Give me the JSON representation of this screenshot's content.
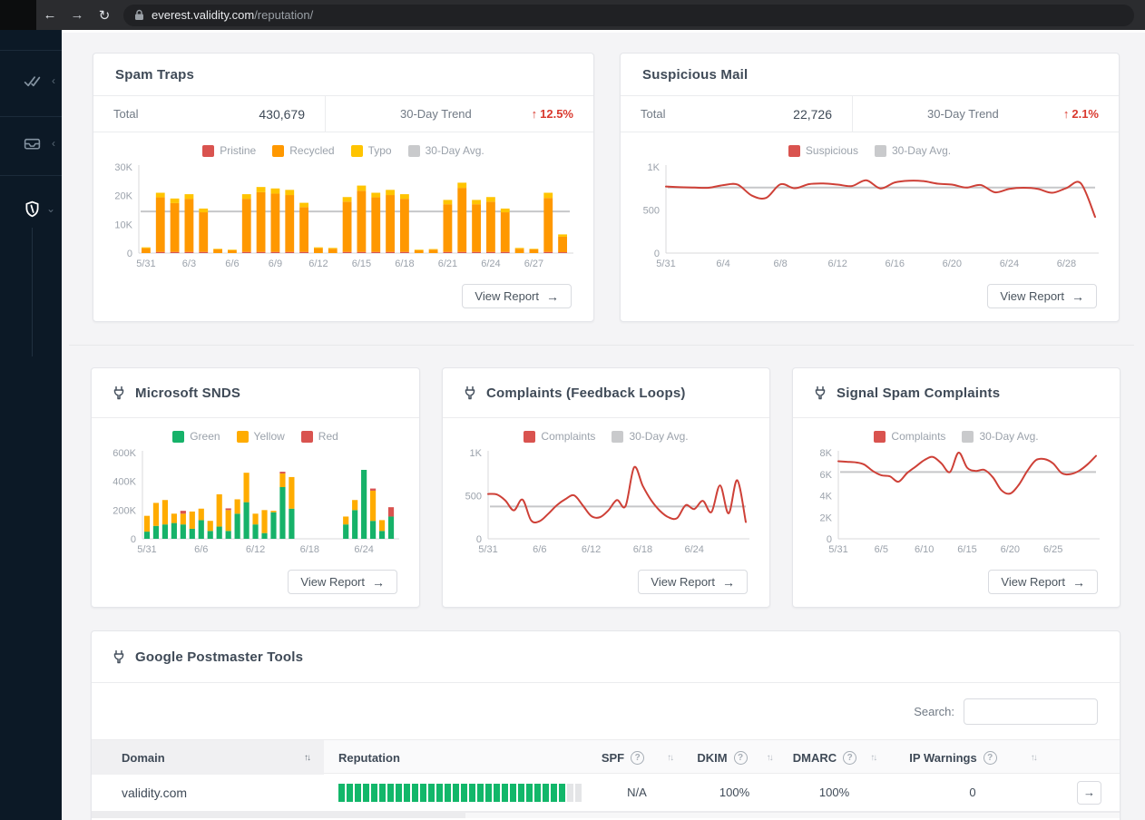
{
  "browser": {
    "url_host": "everest.validity.com",
    "url_path": "/reputation/"
  },
  "sidebar": {
    "items": [
      {
        "name": "approvals"
      },
      {
        "name": "inbox"
      },
      {
        "name": "reputation",
        "active": true
      }
    ]
  },
  "cards": {
    "spam_traps": {
      "title": "Spam Traps",
      "total_label": "Total",
      "total_value": "430,679",
      "trend_label": "30-Day Trend",
      "trend_value": "12.5%",
      "view_report": "View Report"
    },
    "suspicious_mail": {
      "title": "Suspicious Mail",
      "total_label": "Total",
      "total_value": "22,726",
      "trend_label": "30-Day Trend",
      "trend_value": "2.1%",
      "view_report": "View Report"
    },
    "microsoft_snds": {
      "title": "Microsoft SNDS",
      "view_report": "View Report"
    },
    "complaints_fbl": {
      "title": "Complaints (Feedback Loops)",
      "view_report": "View Report"
    },
    "signal_spam": {
      "title": "Signal Spam Complaints",
      "view_report": "View Report"
    },
    "google_postmaster": {
      "title": "Google Postmaster Tools",
      "search_label": "Search:",
      "search_value": "",
      "table": {
        "columns": [
          {
            "label": "Domain",
            "sortable": true
          },
          {
            "label": "Reputation"
          },
          {
            "label": "SPF",
            "help": true,
            "sortable": true
          },
          {
            "label": "DKIM",
            "help": true,
            "sortable": true
          },
          {
            "label": "DMARC",
            "help": true,
            "sortable": true
          },
          {
            "label": "IP Warnings",
            "help": true,
            "sortable": true
          }
        ],
        "rows": [
          {
            "domain": "validity.com",
            "reputation_segments_total": 30,
            "reputation_segments_filled": 28,
            "spf": "N/A",
            "dkim": "100%",
            "dmarc": "100%",
            "ip_warnings": "0"
          }
        ]
      }
    }
  },
  "chart_data": [
    {
      "id": "spam_traps",
      "type": "bar",
      "stacked": true,
      "categories": [
        "5/31",
        "6/1",
        "6/2",
        "6/3",
        "6/4",
        "6/5",
        "6/6",
        "6/7",
        "6/8",
        "6/9",
        "6/10",
        "6/11",
        "6/12",
        "6/13",
        "6/14",
        "6/15",
        "6/16",
        "6/17",
        "6/18",
        "6/19",
        "6/20",
        "6/21",
        "6/22",
        "6/23",
        "6/24",
        "6/25",
        "6/26",
        "6/27",
        "6/28",
        "6/29"
      ],
      "series": [
        {
          "name": "Pristine",
          "color": "#d9534f",
          "values": [
            0,
            0.4,
            0.4,
            0.4,
            0.4,
            0,
            0,
            0.4,
            0.4,
            0.4,
            0.4,
            0.4,
            0,
            0,
            0.4,
            0.4,
            0.4,
            0.4,
            0.4,
            0,
            0,
            0.4,
            0.4,
            0.4,
            0.4,
            0.4,
            0,
            0,
            0.4,
            0.3
          ]
        },
        {
          "name": "Recycled",
          "color": "#ff9800",
          "values": [
            1.7,
            19,
            17,
            18.5,
            13.8,
            1.3,
            1,
            18.5,
            20.8,
            20.3,
            19.8,
            15.6,
            1.7,
            1.5,
            17.5,
            21.3,
            19,
            19.8,
            18.5,
            1,
            1.2,
            16.6,
            22.3,
            16.6,
            17.5,
            13.8,
            1.5,
            1.3,
            18.8,
            5.4
          ]
        },
        {
          "name": "Typo",
          "color": "#ffc400",
          "values": [
            0.3,
            1.6,
            1.6,
            1.6,
            1.3,
            0.2,
            0.2,
            1.6,
            1.8,
            1.8,
            1.8,
            1.5,
            0.3,
            0.3,
            1.6,
            1.8,
            1.6,
            1.8,
            1.6,
            0.2,
            0.2,
            1.5,
            1.8,
            1.5,
            1.6,
            1.3,
            0.3,
            0.2,
            1.8,
            0.8
          ]
        }
      ],
      "legend": [
        {
          "label": "Pristine",
          "color": "#d9534f"
        },
        {
          "label": "Recycled",
          "color": "#ff9800"
        },
        {
          "label": "Typo",
          "color": "#ffc400"
        },
        {
          "label": "30-Day Avg.",
          "color": "#c9cacc"
        }
      ],
      "avg_line": 14.5,
      "ylim": [
        0,
        30
      ],
      "yticks": [
        {
          "v": 0,
          "label": "0"
        },
        {
          "v": 10,
          "label": "10K"
        },
        {
          "v": 20,
          "label": "20K"
        },
        {
          "v": 30,
          "label": "30K"
        }
      ],
      "xticks": [
        "5/31",
        "6/3",
        "6/6",
        "6/9",
        "6/12",
        "6/15",
        "6/18",
        "6/21",
        "6/24",
        "6/27"
      ],
      "unit": "K",
      "padL": 40
    },
    {
      "id": "suspicious_mail",
      "type": "line",
      "categories": [
        "5/31",
        "6/1",
        "6/2",
        "6/3",
        "6/4",
        "6/5",
        "6/6",
        "6/7",
        "6/8",
        "6/9",
        "6/10",
        "6/11",
        "6/12",
        "6/13",
        "6/14",
        "6/15",
        "6/16",
        "6/17",
        "6/18",
        "6/19",
        "6/20",
        "6/21",
        "6/22",
        "6/23",
        "6/24",
        "6/25",
        "6/26",
        "6/27",
        "6/28",
        "6/29",
        "6/30"
      ],
      "series": [
        {
          "name": "Suspicious",
          "color": "#ce4037",
          "values": [
            772,
            765,
            760,
            758,
            788,
            795,
            668,
            640,
            798,
            752,
            800,
            808,
            795,
            778,
            845,
            750,
            820,
            840,
            835,
            805,
            795,
            760,
            790,
            705,
            745,
            758,
            745,
            700,
            755,
            810,
            420
          ]
        }
      ],
      "legend": [
        {
          "label": "Suspicious",
          "color": "#d9534f"
        },
        {
          "label": "30-Day Avg.",
          "color": "#c9cacc"
        }
      ],
      "avg_line": 760,
      "ylim": [
        0,
        1000
      ],
      "yticks": [
        {
          "v": 0,
          "label": "0"
        },
        {
          "v": 500,
          "label": "500"
        },
        {
          "v": 1000,
          "label": "1K"
        }
      ],
      "xticks": [
        "5/31",
        "6/4",
        "6/8",
        "6/12",
        "6/16",
        "6/20",
        "6/24",
        "6/28"
      ],
      "padL": 40
    },
    {
      "id": "microsoft_snds",
      "type": "bar",
      "stacked": true,
      "categories": [
        "5/31",
        "6/1",
        "6/2",
        "6/3",
        "6/4",
        "6/5",
        "6/6",
        "6/7",
        "6/8",
        "6/9",
        "6/10",
        "6/11",
        "6/12",
        "6/13",
        "6/14",
        "6/15",
        "6/16",
        "6/17",
        "6/18",
        "6/19",
        "6/20",
        "6/21",
        "6/22",
        "6/23",
        "6/24",
        "6/25",
        "6/26",
        "6/27"
      ],
      "series": [
        {
          "name": "Green",
          "color": "#16b269",
          "values": [
            50,
            90,
            100,
            110,
            100,
            70,
            130,
            55,
            85,
            55,
            175,
            255,
            100,
            40,
            185,
            360,
            210,
            0,
            0,
            0,
            0,
            0,
            100,
            200,
            480,
            125,
            55,
            155
          ]
        },
        {
          "name": "Yellow",
          "color": "#ffac00",
          "values": [
            110,
            160,
            170,
            65,
            75,
            120,
            80,
            70,
            225,
            145,
            100,
            205,
            75,
            160,
            10,
            95,
            220,
            0,
            0,
            0,
            0,
            0,
            55,
            70,
            0,
            210,
            75,
            0
          ]
        },
        {
          "name": "Red",
          "color": "#d9534f",
          "values": [
            0,
            0,
            0,
            0,
            20,
            0,
            0,
            0,
            0,
            12,
            0,
            0,
            0,
            0,
            0,
            12,
            0,
            0,
            0,
            0,
            0,
            0,
            0,
            0,
            0,
            15,
            0,
            65
          ]
        }
      ],
      "legend": [
        {
          "label": "Green",
          "color": "#16b269"
        },
        {
          "label": "Yellow",
          "color": "#ffac00"
        },
        {
          "label": "Red",
          "color": "#d9534f"
        }
      ],
      "ylim": [
        0,
        600
      ],
      "yticks": [
        {
          "v": 0,
          "label": "0"
        },
        {
          "v": 200,
          "label": "200K"
        },
        {
          "v": 400,
          "label": "400K"
        },
        {
          "v": 600,
          "label": "600K"
        }
      ],
      "xticks": [
        "5/31",
        "6/6",
        "6/12",
        "6/18",
        "6/24"
      ],
      "unit": "K",
      "padL": 46
    },
    {
      "id": "complaints_fbl",
      "type": "line",
      "categories": [
        "5/31",
        "6/1",
        "6/2",
        "6/3",
        "6/4",
        "6/5",
        "6/6",
        "6/7",
        "6/8",
        "6/9",
        "6/10",
        "6/11",
        "6/12",
        "6/13",
        "6/14",
        "6/15",
        "6/16",
        "6/17",
        "6/18",
        "6/19",
        "6/20",
        "6/21",
        "6/22",
        "6/23",
        "6/24",
        "6/25",
        "6/26",
        "6/27",
        "6/28",
        "6/29",
        "6/30"
      ],
      "series": [
        {
          "name": "Complaints",
          "color": "#ce4037",
          "values": [
            520,
            515,
            445,
            330,
            455,
            215,
            205,
            290,
            390,
            460,
            505,
            390,
            265,
            250,
            330,
            450,
            380,
            830,
            615,
            445,
            325,
            250,
            240,
            390,
            345,
            440,
            310,
            620,
            295,
            680,
            195
          ]
        }
      ],
      "legend": [
        {
          "label": "Complaints",
          "color": "#d9534f"
        },
        {
          "label": "30-Day Avg.",
          "color": "#c9cacc"
        }
      ],
      "avg_line": 375,
      "ylim": [
        0,
        1000
      ],
      "yticks": [
        {
          "v": 0,
          "label": "0"
        },
        {
          "v": 500,
          "label": "500"
        },
        {
          "v": 1000,
          "label": "1K"
        }
      ],
      "xticks": [
        "5/31",
        "6/6",
        "6/12",
        "6/18",
        "6/24"
      ],
      "padL": 40
    },
    {
      "id": "signal_spam",
      "type": "line",
      "categories": [
        "5/31",
        "6/1",
        "6/2",
        "6/3",
        "6/4",
        "6/5",
        "6/6",
        "6/7",
        "6/8",
        "6/9",
        "6/10",
        "6/11",
        "6/12",
        "6/13",
        "6/14",
        "6/15",
        "6/16",
        "6/17",
        "6/18",
        "6/19",
        "6/20",
        "6/21",
        "6/22",
        "6/23",
        "6/24",
        "6/25",
        "6/26",
        "6/27",
        "6/28",
        "6/29",
        "6/30"
      ],
      "series": [
        {
          "name": "Complaints",
          "color": "#ce4037",
          "values": [
            7.2,
            7.15,
            7.1,
            6.9,
            6.3,
            5.9,
            5.8,
            5.3,
            6.1,
            6.7,
            7.3,
            7.6,
            7.0,
            6.2,
            8.0,
            6.6,
            6.3,
            6.4,
            5.7,
            4.5,
            4.2,
            5.0,
            6.3,
            7.3,
            7.4,
            7.0,
            6.1,
            6.0,
            6.3,
            6.9,
            7.7
          ]
        }
      ],
      "legend": [
        {
          "label": "Complaints",
          "color": "#d9534f"
        },
        {
          "label": "30-Day Avg.",
          "color": "#c9cacc"
        }
      ],
      "avg_line": 6.2,
      "ylim": [
        0,
        8
      ],
      "yticks": [
        {
          "v": 0,
          "label": "0"
        },
        {
          "v": 2,
          "label": "2K"
        },
        {
          "v": 4,
          "label": "4K"
        },
        {
          "v": 6,
          "label": "6K"
        },
        {
          "v": 8,
          "label": "8K"
        }
      ],
      "xticks": [
        "5/31",
        "6/5",
        "6/10",
        "6/15",
        "6/20",
        "6/25"
      ],
      "unit": "K",
      "padL": 40
    }
  ],
  "colors": {
    "accent_red": "#d9392e",
    "bar_orange": "#ff9800",
    "bar_yellow": "#ffc400",
    "bar_red": "#d9534f",
    "green": "#16b269",
    "avg_gray": "#c6c7c9",
    "sidebar_bg": "#0c1926"
  }
}
